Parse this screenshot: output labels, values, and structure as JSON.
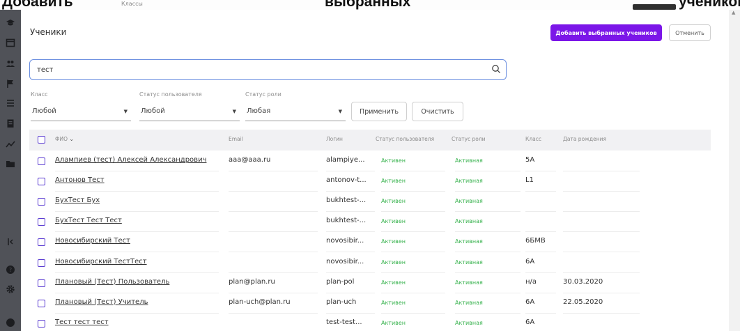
{
  "background": {
    "title_left": "Добавить",
    "title_mid": "выбранных",
    "title_right": "учеников",
    "crumb": "Классы"
  },
  "modal": {
    "title": "Ученики",
    "add_button": "Добавить выбранных учеников",
    "cancel_button": "Отменить"
  },
  "search": {
    "value": "тест"
  },
  "filters": {
    "class_label": "Класс",
    "class_value": "Любой",
    "user_status_label": "Статус пользователя",
    "user_status_value": "Любой",
    "role_status_label": "Статус роли",
    "role_status_value": "Любая",
    "apply_button": "Применить",
    "clear_button": "Очистить"
  },
  "table": {
    "columns": {
      "fio": "ФИО",
      "email": "Email",
      "login": "Логин",
      "user_status": "Статус пользователя",
      "role_status": "Статус роли",
      "class": "Класс",
      "birthdate": "Дата рождения"
    },
    "rows": [
      {
        "fio": "Алампиев (тест) Алексей Александрович",
        "email": "aaa@aaa.ru",
        "login": "alampiye...",
        "user_status": "Активен",
        "role_status": "Активная",
        "class": "5А",
        "birthdate": ""
      },
      {
        "fio": "Антонов Тест",
        "email": "",
        "login": "antonov-t...",
        "user_status": "Активен",
        "role_status": "Активная",
        "class": "L1",
        "birthdate": ""
      },
      {
        "fio": "БухТест Бух",
        "email": "",
        "login": "bukhtest-...",
        "user_status": "Активен",
        "role_status": "Активная",
        "class": "",
        "birthdate": ""
      },
      {
        "fio": "БухТест Тест Тест",
        "email": "",
        "login": "bukhtest-...",
        "user_status": "Активен",
        "role_status": "Активная",
        "class": "",
        "birthdate": ""
      },
      {
        "fio": "Новосибирский Тест",
        "email": "",
        "login": "novosibir...",
        "user_status": "Активен",
        "role_status": "Активная",
        "class": "6БМВ",
        "birthdate": ""
      },
      {
        "fio": "Новосибирский ТестТест",
        "email": "",
        "login": "novosibir...",
        "user_status": "Активен",
        "role_status": "Активная",
        "class": "6А",
        "birthdate": ""
      },
      {
        "fio": "Плановый (Тест) Пользователь",
        "email": "plan@plan.ru",
        "login": "plan-pol",
        "user_status": "Активен",
        "role_status": "Активная",
        "class": "н/а",
        "birthdate": "30.03.2020"
      },
      {
        "fio": "Плановый (Тест) Учитель",
        "email": "plan-uch@plan.ru",
        "login": "plan-uch",
        "user_status": "Активен",
        "role_status": "Активная",
        "class": "6А",
        "birthdate": "22.05.2020"
      },
      {
        "fio": "Тест тест тест",
        "email": "",
        "login": "test-test...",
        "user_status": "Активен",
        "role_status": "Активная",
        "class": "6А",
        "birthdate": ""
      }
    ]
  },
  "colors": {
    "primary": "#7b16e8",
    "status_green": "#37b24d",
    "checkbox": "#5a3bd1",
    "search_border": "#6b8fe0"
  },
  "icons": {
    "sidebar": [
      "graduation-cap-icon",
      "calendar-icon",
      "users-icon",
      "flag-icon",
      "list-icon",
      "clipboard-icon",
      "chart-line-icon",
      "folder-icon",
      "collapse-icon",
      "help-icon",
      "gear-icon",
      "avatar-icon"
    ],
    "search": "search-icon",
    "sort": "chevron-down-icon"
  }
}
